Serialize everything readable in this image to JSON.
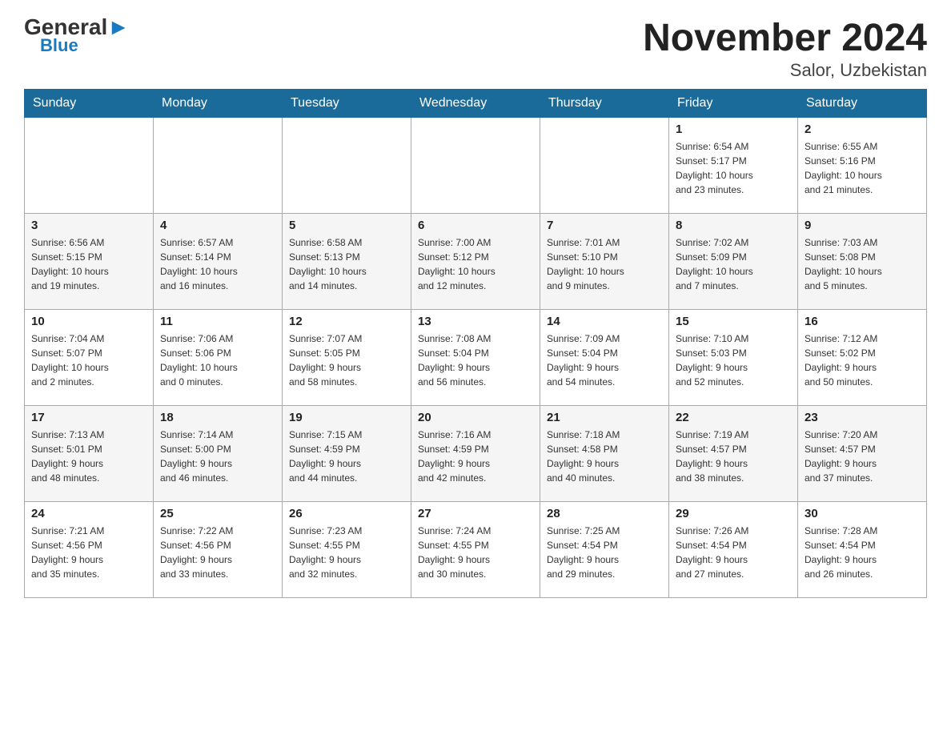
{
  "header": {
    "logo_general": "General",
    "logo_blue": "Blue",
    "title": "November 2024",
    "location": "Salor, Uzbekistan"
  },
  "days_of_week": [
    "Sunday",
    "Monday",
    "Tuesday",
    "Wednesday",
    "Thursday",
    "Friday",
    "Saturday"
  ],
  "weeks": [
    [
      {
        "day": "",
        "info": ""
      },
      {
        "day": "",
        "info": ""
      },
      {
        "day": "",
        "info": ""
      },
      {
        "day": "",
        "info": ""
      },
      {
        "day": "",
        "info": ""
      },
      {
        "day": "1",
        "info": "Sunrise: 6:54 AM\nSunset: 5:17 PM\nDaylight: 10 hours\nand 23 minutes."
      },
      {
        "day": "2",
        "info": "Sunrise: 6:55 AM\nSunset: 5:16 PM\nDaylight: 10 hours\nand 21 minutes."
      }
    ],
    [
      {
        "day": "3",
        "info": "Sunrise: 6:56 AM\nSunset: 5:15 PM\nDaylight: 10 hours\nand 19 minutes."
      },
      {
        "day": "4",
        "info": "Sunrise: 6:57 AM\nSunset: 5:14 PM\nDaylight: 10 hours\nand 16 minutes."
      },
      {
        "day": "5",
        "info": "Sunrise: 6:58 AM\nSunset: 5:13 PM\nDaylight: 10 hours\nand 14 minutes."
      },
      {
        "day": "6",
        "info": "Sunrise: 7:00 AM\nSunset: 5:12 PM\nDaylight: 10 hours\nand 12 minutes."
      },
      {
        "day": "7",
        "info": "Sunrise: 7:01 AM\nSunset: 5:10 PM\nDaylight: 10 hours\nand 9 minutes."
      },
      {
        "day": "8",
        "info": "Sunrise: 7:02 AM\nSunset: 5:09 PM\nDaylight: 10 hours\nand 7 minutes."
      },
      {
        "day": "9",
        "info": "Sunrise: 7:03 AM\nSunset: 5:08 PM\nDaylight: 10 hours\nand 5 minutes."
      }
    ],
    [
      {
        "day": "10",
        "info": "Sunrise: 7:04 AM\nSunset: 5:07 PM\nDaylight: 10 hours\nand 2 minutes."
      },
      {
        "day": "11",
        "info": "Sunrise: 7:06 AM\nSunset: 5:06 PM\nDaylight: 10 hours\nand 0 minutes."
      },
      {
        "day": "12",
        "info": "Sunrise: 7:07 AM\nSunset: 5:05 PM\nDaylight: 9 hours\nand 58 minutes."
      },
      {
        "day": "13",
        "info": "Sunrise: 7:08 AM\nSunset: 5:04 PM\nDaylight: 9 hours\nand 56 minutes."
      },
      {
        "day": "14",
        "info": "Sunrise: 7:09 AM\nSunset: 5:04 PM\nDaylight: 9 hours\nand 54 minutes."
      },
      {
        "day": "15",
        "info": "Sunrise: 7:10 AM\nSunset: 5:03 PM\nDaylight: 9 hours\nand 52 minutes."
      },
      {
        "day": "16",
        "info": "Sunrise: 7:12 AM\nSunset: 5:02 PM\nDaylight: 9 hours\nand 50 minutes."
      }
    ],
    [
      {
        "day": "17",
        "info": "Sunrise: 7:13 AM\nSunset: 5:01 PM\nDaylight: 9 hours\nand 48 minutes."
      },
      {
        "day": "18",
        "info": "Sunrise: 7:14 AM\nSunset: 5:00 PM\nDaylight: 9 hours\nand 46 minutes."
      },
      {
        "day": "19",
        "info": "Sunrise: 7:15 AM\nSunset: 4:59 PM\nDaylight: 9 hours\nand 44 minutes."
      },
      {
        "day": "20",
        "info": "Sunrise: 7:16 AM\nSunset: 4:59 PM\nDaylight: 9 hours\nand 42 minutes."
      },
      {
        "day": "21",
        "info": "Sunrise: 7:18 AM\nSunset: 4:58 PM\nDaylight: 9 hours\nand 40 minutes."
      },
      {
        "day": "22",
        "info": "Sunrise: 7:19 AM\nSunset: 4:57 PM\nDaylight: 9 hours\nand 38 minutes."
      },
      {
        "day": "23",
        "info": "Sunrise: 7:20 AM\nSunset: 4:57 PM\nDaylight: 9 hours\nand 37 minutes."
      }
    ],
    [
      {
        "day": "24",
        "info": "Sunrise: 7:21 AM\nSunset: 4:56 PM\nDaylight: 9 hours\nand 35 minutes."
      },
      {
        "day": "25",
        "info": "Sunrise: 7:22 AM\nSunset: 4:56 PM\nDaylight: 9 hours\nand 33 minutes."
      },
      {
        "day": "26",
        "info": "Sunrise: 7:23 AM\nSunset: 4:55 PM\nDaylight: 9 hours\nand 32 minutes."
      },
      {
        "day": "27",
        "info": "Sunrise: 7:24 AM\nSunset: 4:55 PM\nDaylight: 9 hours\nand 30 minutes."
      },
      {
        "day": "28",
        "info": "Sunrise: 7:25 AM\nSunset: 4:54 PM\nDaylight: 9 hours\nand 29 minutes."
      },
      {
        "day": "29",
        "info": "Sunrise: 7:26 AM\nSunset: 4:54 PM\nDaylight: 9 hours\nand 27 minutes."
      },
      {
        "day": "30",
        "info": "Sunrise: 7:28 AM\nSunset: 4:54 PM\nDaylight: 9 hours\nand 26 minutes."
      }
    ]
  ]
}
